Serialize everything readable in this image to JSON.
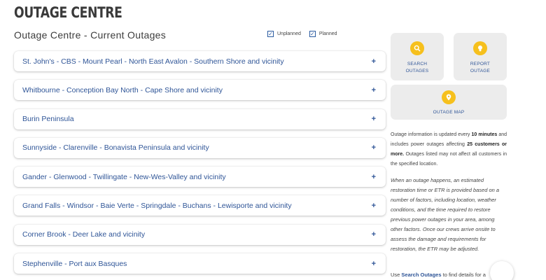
{
  "header": {
    "title": "OUTAGE CENTRE"
  },
  "section": {
    "title": "Outage Centre - Current Outages"
  },
  "filters": [
    {
      "label": "Unplanned",
      "checked": true
    },
    {
      "label": "Planned",
      "checked": true
    }
  ],
  "outages": [
    {
      "label": "St. John's - CBS - Mount Pearl - North East Avalon - Southern Shore and vicinity",
      "toggle": "+"
    },
    {
      "label": "Whitbourne - Conception Bay North - Cape Shore and vicinity",
      "toggle": "+"
    },
    {
      "label": "Burin Peninsula",
      "toggle": "+"
    },
    {
      "label": "Sunnyside - Clarenville - Bonavista Peninsula and vicinity",
      "toggle": "+"
    },
    {
      "label": "Gander - Glenwood - Twillingate - New-Wes-Valley and vicinity",
      "toggle": "+"
    },
    {
      "label": "Grand Falls - Windsor - Baie Verte - Springdale - Buchans - Lewisporte and vicinity",
      "toggle": "+"
    },
    {
      "label": "Corner Brook - Deer Lake and vicinity",
      "toggle": "+"
    },
    {
      "label": "Stephenville - Port aux Basques",
      "toggle": "+"
    }
  ],
  "tiles": {
    "search": {
      "line1": "SEARCH",
      "line2": "OUTAGES",
      "icon": "search-icon"
    },
    "report": {
      "line1": "REPORT",
      "line2": "OUTAGE",
      "icon": "bulb-icon"
    },
    "map": {
      "line1": "OUTAGE MAP",
      "icon": "map-pin-icon"
    }
  },
  "info": {
    "p1_a": "Outage information is updated every ",
    "p1_b": "10 minutes",
    "p1_c": " and includes power outages affecting ",
    "p1_d": "25 customers or more.",
    "p1_e": " Outages listed may not affect all customers in the specified location.",
    "p2": "When an outage happens, an estimated restoration time or ETR is provided based on a number of factors, including location, weather conditions, and the time required to restore previous power outages in your area, among other factors. Once our crews arrive onsite to assess the damage and requirements for restoration, the ETR may be adjusted.",
    "p3_a": "Use ",
    "p3_b": "Search Outages",
    "p3_c": " to find details for a"
  },
  "colors": {
    "accent": "#2f5597",
    "tile_icon": "#f6c01d",
    "tile_bg": "#ececec"
  }
}
